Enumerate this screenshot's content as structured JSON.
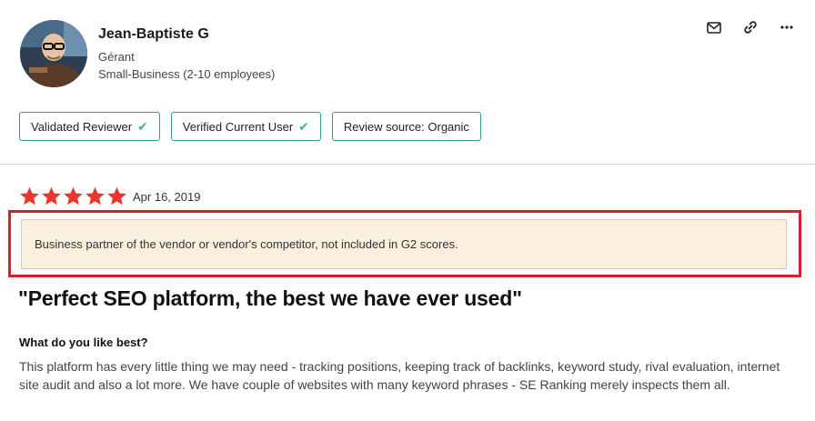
{
  "reviewer": {
    "name": "Jean-Baptiste G",
    "role": "Gérant",
    "company_size": "Small-Business (2-10 employees)"
  },
  "actions": [
    {
      "icon": "mail-icon"
    },
    {
      "icon": "link-icon"
    },
    {
      "icon": "more-icon"
    }
  ],
  "badges": [
    {
      "label": "Validated Reviewer",
      "checked": true
    },
    {
      "label": "Verified Current User",
      "checked": true
    },
    {
      "label": "Review source: Organic",
      "checked": false
    }
  ],
  "review": {
    "rating": 5,
    "rating_max": 5,
    "date": "Apr 16, 2019",
    "notice": "Business partner of the vendor or vendor's competitor, not included in G2 scores.",
    "title": "\"Perfect SEO platform, the best we have ever used\"",
    "question": "What do you like best?",
    "answer": "This platform has every little thing we may need - tracking positions, keeping track of backlinks, keyword study, rival evaluation, internet site audit and also a lot more. We have couple of websites with many keyword phrases - SE Ranking merely inspects them all."
  },
  "colors": {
    "star": "#e8372f",
    "badge_border": "#2f9e8f",
    "check": "#2fbf86",
    "highlight_border": "#d9202a",
    "notice_bg": "#fbf0df"
  }
}
